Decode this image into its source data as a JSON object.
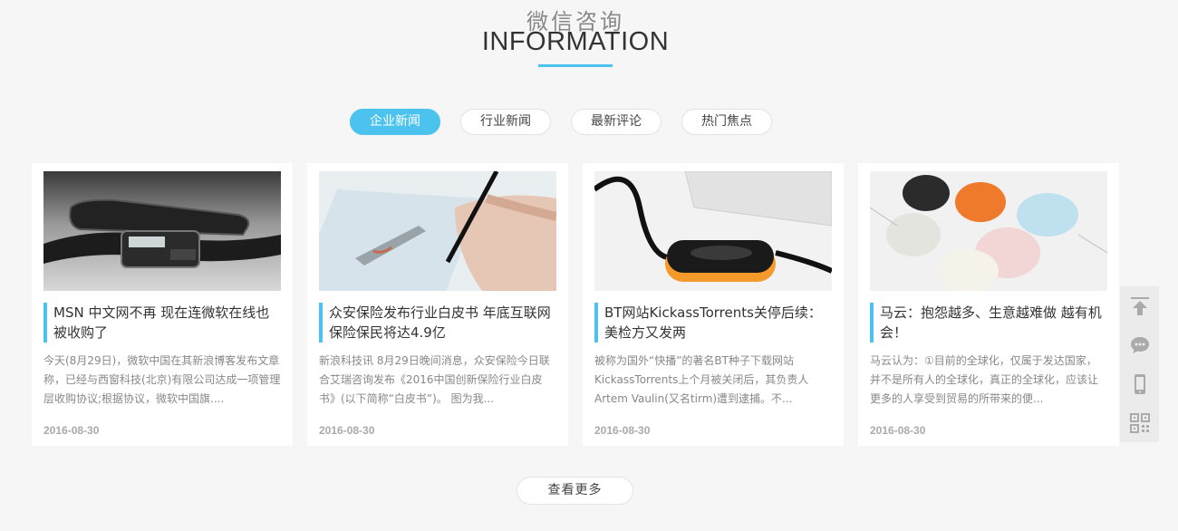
{
  "section": {
    "title_cn": "微信咨询",
    "title_en": "INFORMATION"
  },
  "tabs": [
    {
      "label": "企业新闻",
      "active": true
    },
    {
      "label": "行业新闻",
      "active": false
    },
    {
      "label": "最新评论",
      "active": false
    },
    {
      "label": "热门焦点",
      "active": false
    }
  ],
  "articles": [
    {
      "title": "MSN 中文网不再 现在连微软在线也被收购了",
      "summary": "今天(8月29日)，微软中国在其新浪博客发布文章称，已经与西窗科技(北京)有限公司达成一项管理层收购协议;根据协议，微软中国旗....",
      "date": "2016-08-30",
      "image": "smart-watch-photo"
    },
    {
      "title": "众安保险发布行业白皮书 年底互联网保险保民将达4.9亿",
      "summary": "新浪科技讯 8月29日晚间消息，众安保险今日联合艾瑞咨询发布《2016中国创新保险行业白皮书》(以下简称“白皮书”)。 图为我...",
      "date": "2016-08-30",
      "image": "hand-drawing-photo"
    },
    {
      "title": "BT网站KickassTorrents关停后续：美检方又发两",
      "summary": "被称为国外“快播”的著名BT种子下载网站KickassTorrents上个月被关闭后，其负责人Artem Vaulin(又名tirm)遭到逮捕。不...",
      "date": "2016-08-30",
      "image": "usb-device-photo"
    },
    {
      "title": "马云：抱怨越多、生意越难做 越有机会！",
      "summary": "马云认为：①目前的全球化，仅属于发达国家，并不是所有人的全球化，真正的全球化，应该让更多的人享受到贸易的所带来的便...",
      "date": "2016-08-30",
      "image": "colorful-mice-photo"
    }
  ],
  "more_button": "查看更多",
  "side_toolbar": [
    "back-to-top-icon",
    "chat-icon",
    "mobile-icon",
    "qr-code-icon"
  ],
  "colors": {
    "accent": "#4cc3ee",
    "background": "#f6f6f6"
  }
}
